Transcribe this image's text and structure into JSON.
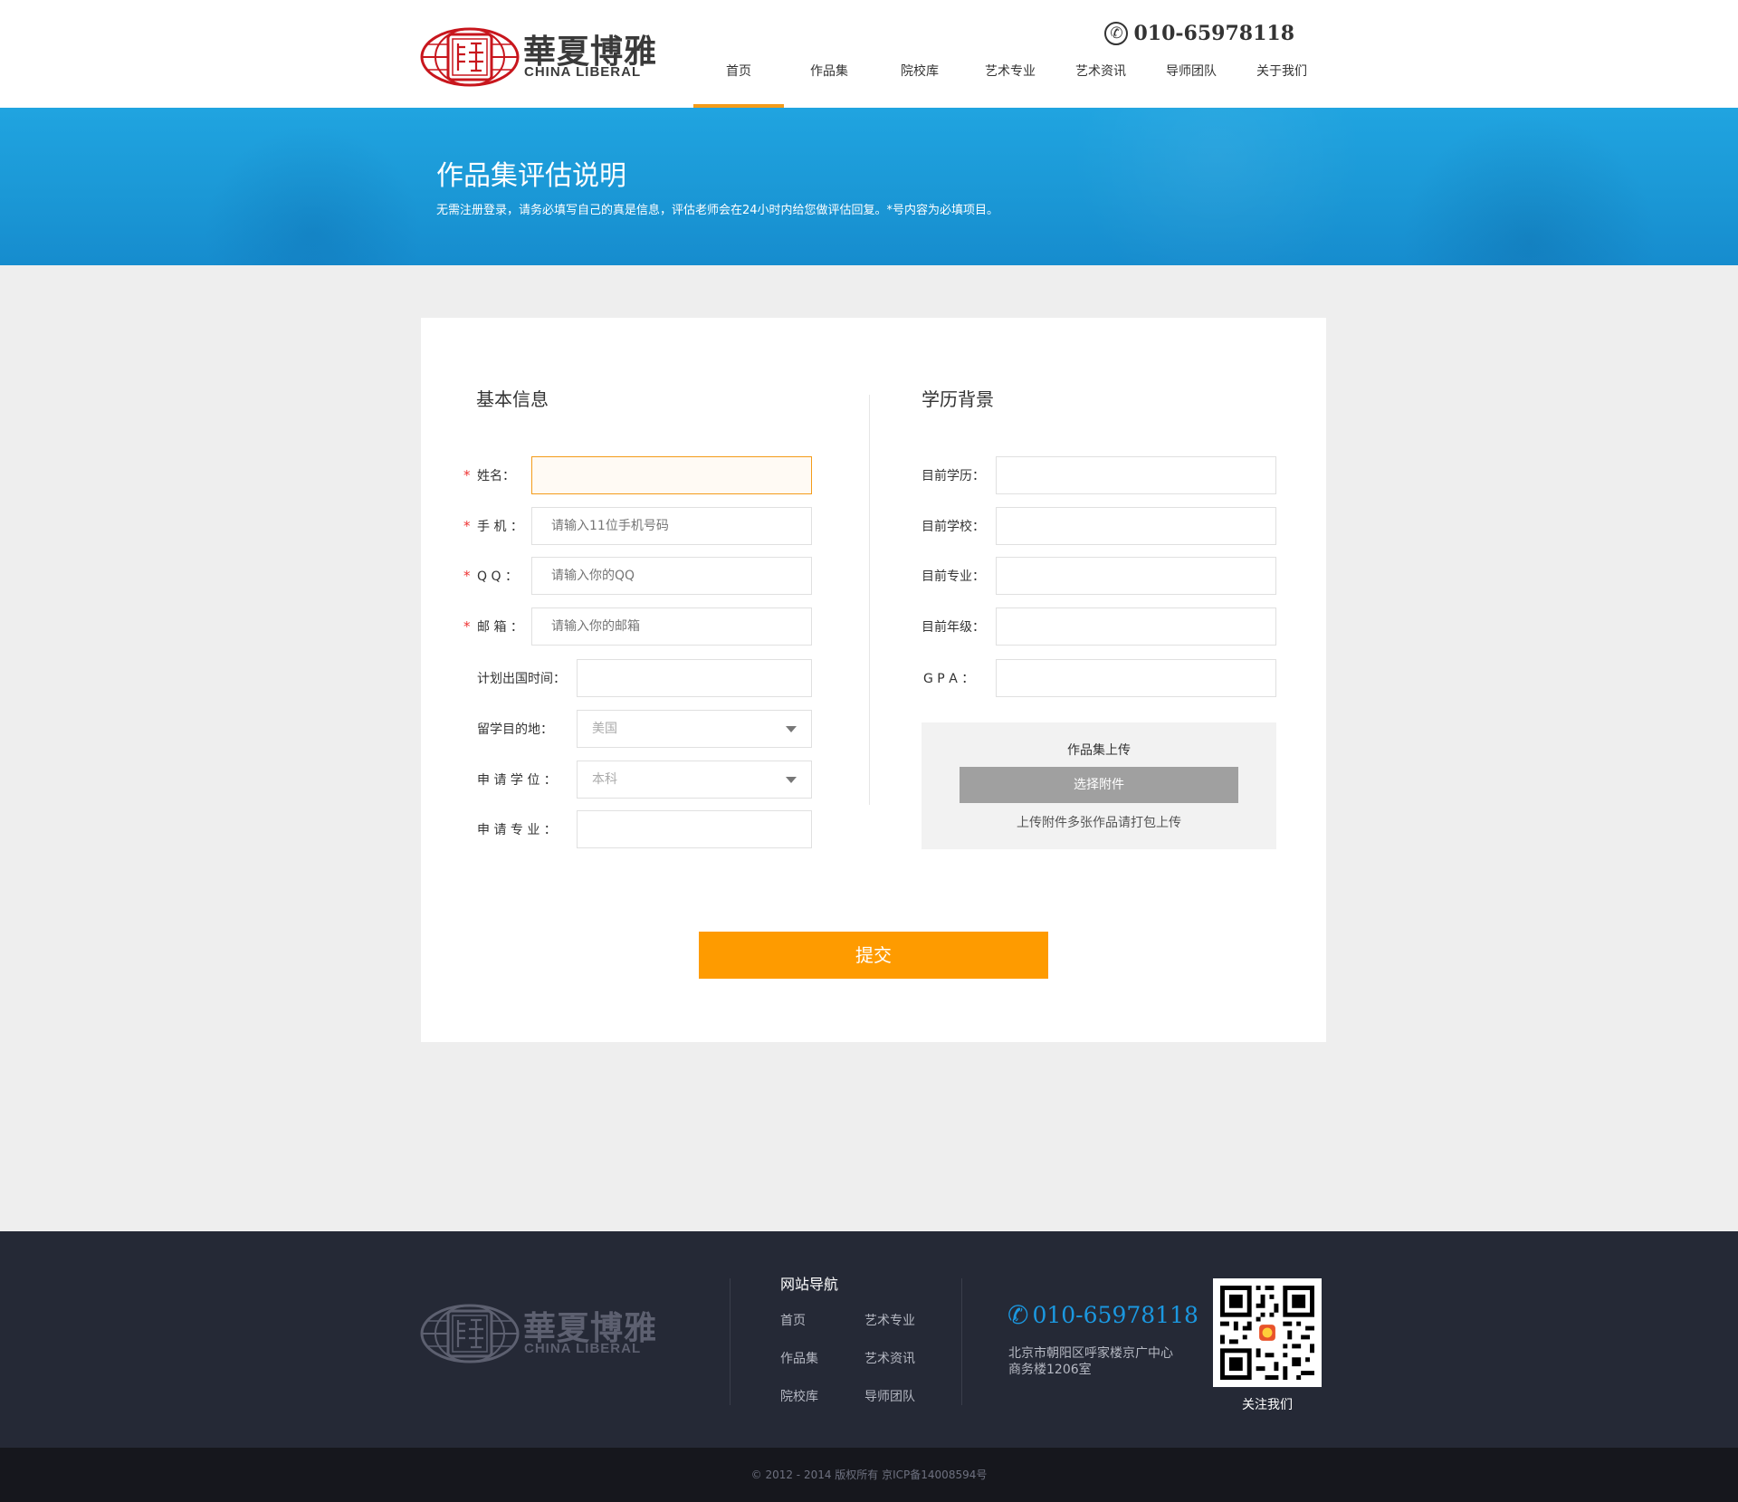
{
  "brand": {
    "name_cn": "華夏博雅",
    "name_en": "CHINA LIBERAL",
    "seal_char": "博雅"
  },
  "header": {
    "phone": "010-65978118",
    "nav": [
      {
        "label": "首页",
        "active": true
      },
      {
        "label": "作品集"
      },
      {
        "label": "院校库"
      },
      {
        "label": "艺术专业"
      },
      {
        "label": "艺术资讯"
      },
      {
        "label": "导师团队"
      },
      {
        "label": "关于我们"
      }
    ]
  },
  "banner": {
    "title": "作品集评估说明",
    "subtitle": "无需注册登录，请务必填写自己的真是信息，评估老师会在24小时内给您做评估回复。*号内容为必填项目。"
  },
  "form": {
    "basic_title": "基本信息",
    "edu_title": "学历背景",
    "required_mark": "*",
    "fields": {
      "name": {
        "label": "姓名：",
        "value": "",
        "placeholder": ""
      },
      "phone": {
        "label": "手 机 ：",
        "placeholder": "请输入11位手机号码"
      },
      "qq": {
        "label": "Q Q ：",
        "placeholder": "请输入你的QQ"
      },
      "email": {
        "label": "邮 箱 ：",
        "placeholder": "请输入你的邮箱"
      },
      "plan_time": {
        "label": "计划出国时间：",
        "placeholder": ""
      },
      "destination": {
        "label": "留学目的地：",
        "selected": "美国"
      },
      "degree": {
        "label": "申 请 学 位 ：",
        "selected": "本科"
      },
      "major": {
        "label": "申 请 专 业 ：",
        "placeholder": ""
      },
      "cur_edu": {
        "label": "目前学历："
      },
      "cur_school": {
        "label": "目前学校："
      },
      "cur_major": {
        "label": "目前专业："
      },
      "cur_grade": {
        "label": "目前年级："
      },
      "gpa": {
        "label": "G P A ："
      }
    },
    "upload": {
      "title": "作品集上传",
      "button": "选择附件",
      "hint": "上传附件多张作品请打包上传"
    },
    "submit_label": "提交"
  },
  "footer": {
    "nav_title": "网站导航",
    "links": [
      "首页",
      "艺术专业",
      "作品集",
      "艺术资讯",
      "院校库",
      "导师团队"
    ],
    "phone": "010-65978118",
    "address": "北京市朝阳区呼家楼京广中心商务楼1206室",
    "qr_label": "关注我们",
    "copyright": "© 2012 - 2014 版权所有 京ICP备14008594号"
  },
  "colors": {
    "accent": "#fe9b00",
    "banner": "#1b98d6",
    "footer": "#252936",
    "brand_red": "#c8161d",
    "link_blue": "#1b98e0"
  }
}
